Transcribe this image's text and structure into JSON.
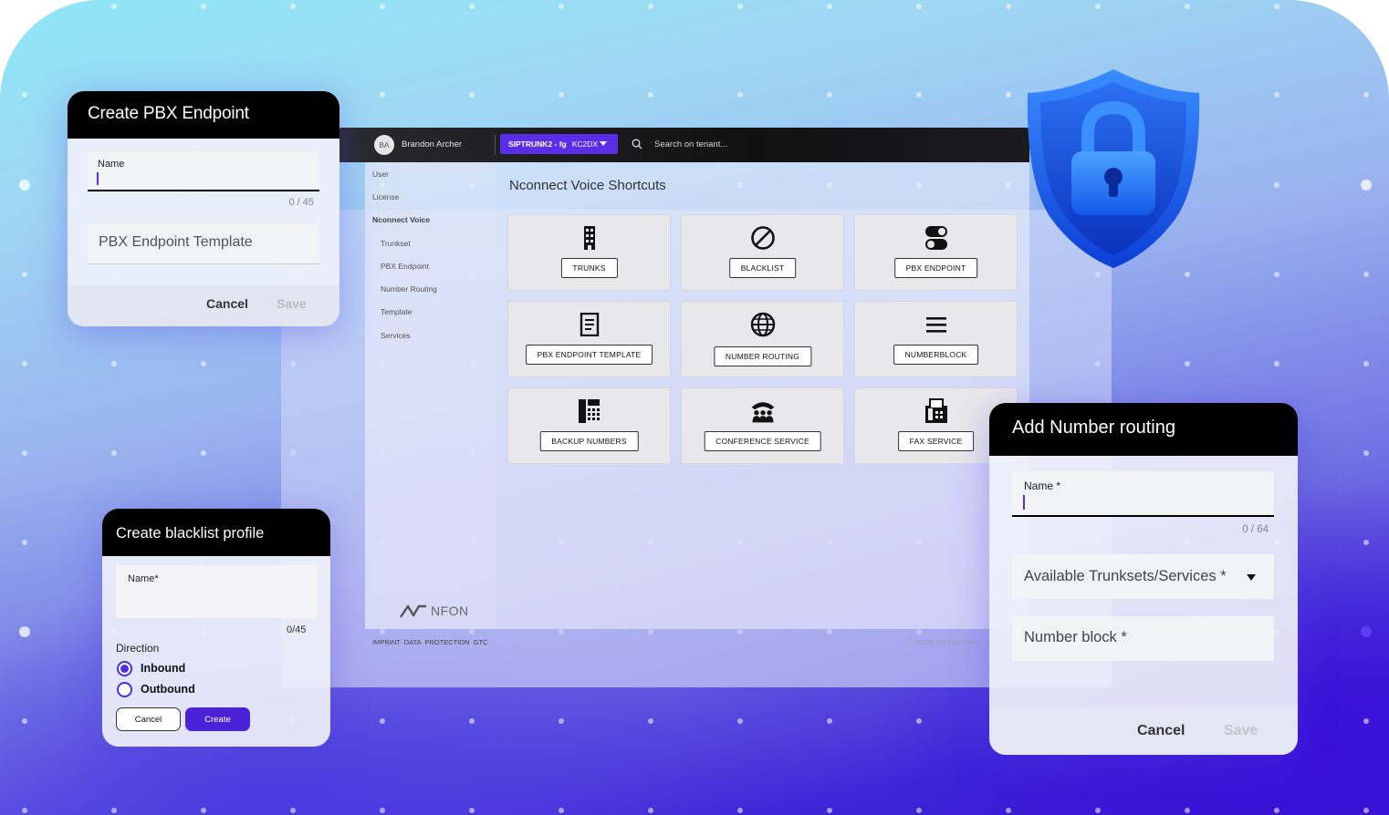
{
  "app": {
    "user_initials": "BA",
    "user_name": "Brandon Archer",
    "trunk_selector": {
      "name": "SIPTRUNK2 - fg",
      "code": "KC2DX"
    },
    "search_placeholder": "Search on tenant...",
    "sidebar": [
      {
        "label": "User",
        "level": "top"
      },
      {
        "label": "License",
        "level": "top"
      },
      {
        "label": "Nconnect Voice",
        "level": "section"
      },
      {
        "label": "Trunkset",
        "level": "sub"
      },
      {
        "label": "PBX Endpoint",
        "level": "sub"
      },
      {
        "label": "Number Routing",
        "level": "sub"
      },
      {
        "label": "Template",
        "level": "sub"
      },
      {
        "label": "Services",
        "level": "sub"
      }
    ],
    "logo_text": "NFON",
    "page_title": "Nconnect Voice Shortcuts",
    "tiles": [
      {
        "label": "TRUNKS",
        "icon": "building-icon"
      },
      {
        "label": "BLACKLIST",
        "icon": "block-icon"
      },
      {
        "label": "PBX ENDPOINT",
        "icon": "toggle-icon"
      },
      {
        "label": "PBX ENDPOINT TEMPLATE",
        "icon": "document-icon"
      },
      {
        "label": "NUMBER ROUTING",
        "icon": "globe-icon"
      },
      {
        "label": "NUMBERBLOCK",
        "icon": "menu-icon"
      },
      {
        "label": "BACKUP NUMBERS",
        "icon": "phone-keypad-icon"
      },
      {
        "label": "CONFERENCE SERVICE",
        "icon": "conference-icon"
      },
      {
        "label": "FAX SERVICE",
        "icon": "fax-icon"
      }
    ],
    "footer_links": [
      "IMPRINT",
      "DATA PROTECTION",
      "GTC"
    ],
    "copyright": "© NFON 2023 All rights"
  },
  "pbx_dialog": {
    "title": "Create PBX Endpoint",
    "name_label": "Name",
    "name_counter": "0 / 45",
    "template_placeholder": "PBX Endpoint Template",
    "cancel": "Cancel",
    "save": "Save"
  },
  "blacklist_dialog": {
    "title": "Create blacklist profile",
    "name_label": "Name*",
    "name_counter": "0/45",
    "direction_label": "Direction",
    "options": [
      "Inbound",
      "Outbound"
    ],
    "selected": "Inbound",
    "cancel": "Cancel",
    "create": "Create"
  },
  "routing_dialog": {
    "title": "Add Number routing",
    "name_label": "Name *",
    "name_counter": "0 / 64",
    "trunksets_placeholder": "Available Trunksets/Services *",
    "numberblock_placeholder": "Number block *",
    "cancel": "Cancel",
    "save": "Save"
  },
  "colors": {
    "accent": "#5a2ee8",
    "header": "#000000",
    "shield": "#1a5cf0"
  }
}
